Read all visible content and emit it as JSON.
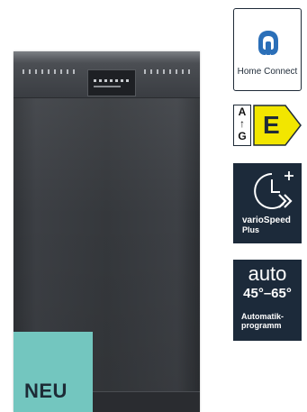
{
  "product": {
    "name": "dishwasher-product-image",
    "badge_text": "NEU",
    "badge_color": "#73c6bf"
  },
  "features": {
    "home_connect": {
      "icon": "home-connect-icon",
      "label": "Home Connect"
    },
    "energy_label": {
      "scale_top": "A",
      "scale_arrow": "↑",
      "scale_bottom": "G",
      "class": "E",
      "arrow_color": "#f2e600"
    },
    "vario_speed": {
      "icon": "clock-fast-forward-icon",
      "line1": "varioSpeed",
      "line2": "Plus"
    },
    "auto_program": {
      "title": "auto",
      "range": "45°–65°",
      "line1": "Automatik-",
      "line2": "programm"
    }
  },
  "colors": {
    "navy": "#1c2a3a",
    "appliance": "#35383c"
  }
}
